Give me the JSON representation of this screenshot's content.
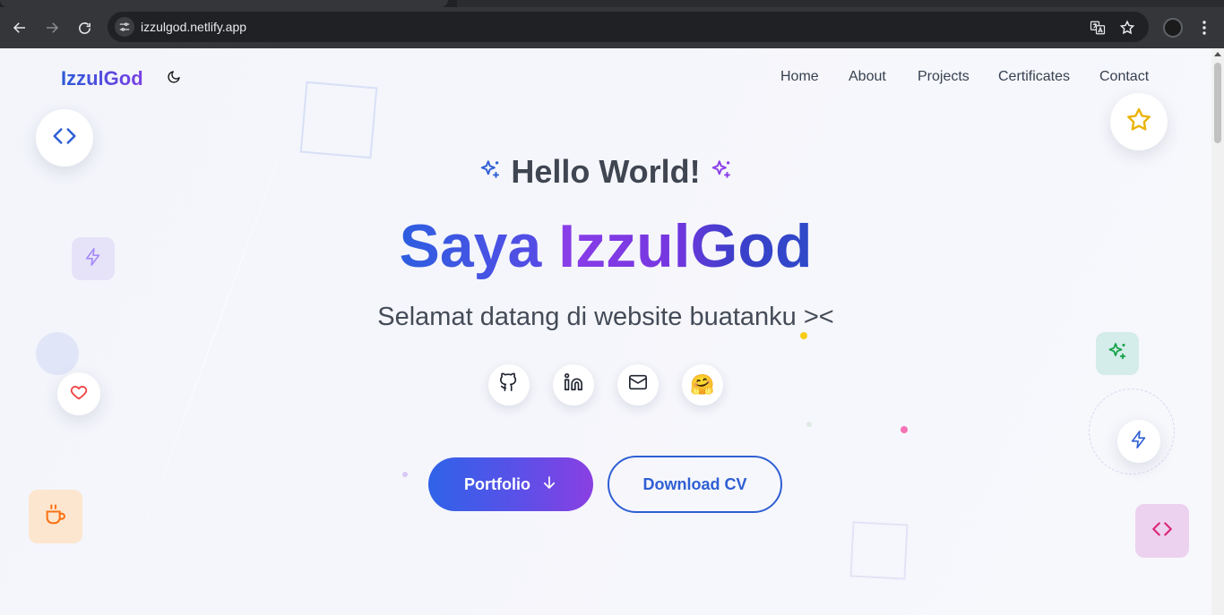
{
  "browser": {
    "url": "izzulgod.netlify.app",
    "icons": [
      "back-icon",
      "forward-icon",
      "reload-icon",
      "site-settings-icon",
      "translate-icon",
      "bookmark-star-icon",
      "profile-avatar",
      "more-menu-icon"
    ]
  },
  "header": {
    "brand": "IzzulGod",
    "nav": [
      {
        "label": "Home"
      },
      {
        "label": "About"
      },
      {
        "label": "Projects"
      },
      {
        "label": "Certificates"
      },
      {
        "label": "Contact"
      }
    ]
  },
  "hero": {
    "greeting": "Hello World!",
    "headline_part1": "Saya ",
    "headline_part2": "IzzulGod",
    "subtitle": "Selamat datang di website buatanku ><",
    "social_links": [
      "github-icon",
      "linkedin-icon",
      "mail-icon",
      "hugging-face-icon"
    ],
    "hugging_face_emoji": "🤗",
    "primary_button": "Portfolio",
    "secondary_button": "Download CV"
  },
  "colors": {
    "brand_start": "#2b5bd7",
    "brand_end": "#7b3fe4",
    "accent_blue": "#2f5fd4",
    "star_yellow": "#eab308",
    "heart_red": "#ef4444",
    "coffee_orange": "#f97316",
    "sparkle_green": "#16a34a",
    "code_pink": "#db2777"
  }
}
